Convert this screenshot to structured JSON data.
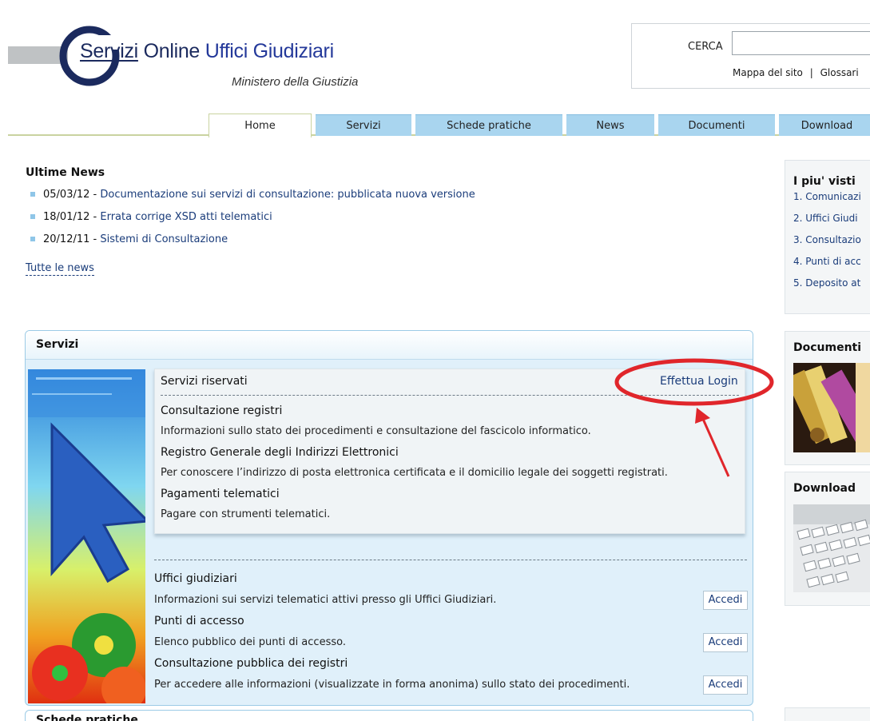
{
  "header": {
    "logo_part1": "Servizi",
    "logo_part2": " Online ",
    "logo_part3": "Uffici Giudiziari",
    "subtitle": "Ministero della Giustizia",
    "search_label": "CERCA",
    "search_value": "",
    "link_map": "Mappa del sito",
    "link_sep": "|",
    "link_glossary": "Glossari"
  },
  "tabs": [
    {
      "label": "Home"
    },
    {
      "label": "Servizi"
    },
    {
      "label": "Schede pratiche"
    },
    {
      "label": "News"
    },
    {
      "label": "Documenti"
    },
    {
      "label": "Download"
    }
  ],
  "news": {
    "title": "Ultime News",
    "items": [
      {
        "date": "05/03/12",
        "sep": " - ",
        "text": "Documentazione sui servizi di consultazione: pubblicata nuova versione"
      },
      {
        "date": "18/01/12",
        "sep": " - ",
        "text": "Errata corrige XSD atti telematici"
      },
      {
        "date": "20/12/11",
        "sep": " - ",
        "text": "Sistemi di Consultazione"
      }
    ],
    "all_link": "Tutte le news"
  },
  "servizi": {
    "title": "Servizi",
    "riservati_title": "Servizi riservati",
    "login_label": "Effettua Login",
    "riservati_items": [
      {
        "name": "Consultazione registri",
        "desc": "Informazioni sullo stato dei procedimenti e consultazione del fascicolo informatico."
      },
      {
        "name": "Registro Generale degli Indirizzi Elettronici",
        "desc": "Per conoscere l’indirizzo di posta elettronica certificata e il domicilio legale dei soggetti registrati."
      },
      {
        "name": "Pagamenti telematici",
        "desc": "Pagare con strumenti telematici."
      }
    ],
    "public_items": [
      {
        "name": "Uffici giudiziari",
        "desc": "Informazioni sui servizi telematici attivi presso gli Uffici Giudiziari.",
        "button": "Accedi"
      },
      {
        "name": "Punti di accesso",
        "desc": "Elenco pubblico dei punti di accesso.",
        "button": "Accedi"
      },
      {
        "name": "Consultazione pubblica dei registri",
        "desc": "Per accedere alle informazioni (visualizzate in forma anonima) sullo stato dei procedimenti.",
        "button": "Accedi"
      }
    ],
    "next_panel_title": "Schede pratiche"
  },
  "sidebar": {
    "visti_title": "I piu' visti",
    "visti_items": [
      {
        "label": "1. Comunicazi"
      },
      {
        "label": "2. Uffici Giudi"
      },
      {
        "label": "3. Consultazio"
      },
      {
        "label": "4. Punti di acc"
      },
      {
        "label": "5. Deposito at"
      }
    ],
    "documenti_title": "Documenti",
    "download_title": "Download"
  },
  "colors": {
    "tab_bg": "#a9d5ef",
    "brand_blue": "#1b2a5e",
    "panel_bg": "#e0f0fa",
    "annotation_red": "#e0262b"
  }
}
